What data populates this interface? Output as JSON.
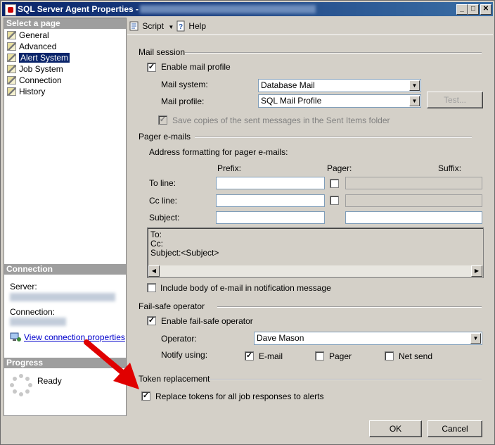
{
  "window": {
    "title": "SQL Server Agent Properties - ",
    "minimize": "_",
    "maximize": "□",
    "close": "✕"
  },
  "left": {
    "select_page_header": "Select a page",
    "pages": [
      {
        "label": "General"
      },
      {
        "label": "Advanced"
      },
      {
        "label": "Alert System"
      },
      {
        "label": "Job System"
      },
      {
        "label": "Connection"
      },
      {
        "label": "History"
      }
    ],
    "selected_index": 2,
    "connection_header": "Connection",
    "server_label": "Server:",
    "connection_label": "Connection:",
    "view_connection_link": "View connection properties",
    "progress_header": "Progress",
    "progress_status": "Ready"
  },
  "toolbar": {
    "script_label": "Script",
    "help_label": "Help"
  },
  "mail_session": {
    "group_label": "Mail session",
    "enable_mail_profile": "Enable mail profile",
    "enable_mail_profile_checked": true,
    "mail_system_label": "Mail system:",
    "mail_system_value": "Database Mail",
    "mail_profile_label": "Mail profile:",
    "mail_profile_value": "SQL Mail Profile",
    "test_button": "Test...",
    "save_copies": "Save copies of the sent messages in the Sent Items folder",
    "save_copies_checked": true
  },
  "pager": {
    "group_label": "Pager e-mails",
    "address_formatting": "Address formatting for pager e-mails:",
    "prefix_header": "Prefix:",
    "pager_header": "Pager:",
    "suffix_header": "Suffix:",
    "to_line": "To line:",
    "cc_line": "Cc line:",
    "subject": "Subject:",
    "preview_lines": [
      "To:",
      "Cc:",
      "Subject:<Subject>"
    ],
    "include_body": "Include body of e-mail in notification message",
    "include_body_checked": false
  },
  "failsafe": {
    "group_label": "Fail-safe operator",
    "enable_failsafe": "Enable fail-safe operator",
    "enable_failsafe_checked": true,
    "operator_label": "Operator:",
    "operator_value": "Dave Mason",
    "notify_using_label": "Notify using:",
    "email_label": "E-mail",
    "email_checked": true,
    "pager_label": "Pager",
    "pager_checked": false,
    "netsend_label": "Net send",
    "netsend_checked": false
  },
  "token": {
    "group_label": "Token replacement",
    "replace_tokens": "Replace tokens for all job responses to alerts",
    "replace_tokens_checked": true
  },
  "footer": {
    "ok_button": "OK",
    "cancel_button": "Cancel"
  },
  "colors": {
    "titlebar": "#0a246a",
    "dialog_face": "#d4d0c8",
    "selection": "#0a246a",
    "annotation_arrow": "#e00000"
  }
}
